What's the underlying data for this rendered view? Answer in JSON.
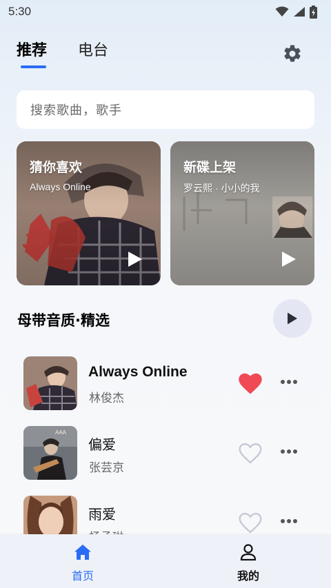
{
  "status_bar": {
    "time": "5:30",
    "icons": [
      "wifi-icon",
      "cellular-signal-icon",
      "battery-icon"
    ]
  },
  "header": {
    "tabs": [
      {
        "label": "推荐",
        "active": true
      },
      {
        "label": "电台",
        "active": false
      }
    ],
    "settings_icon": "gear-icon"
  },
  "search": {
    "placeholder": "搜索歌曲，歌手"
  },
  "cards": [
    {
      "title": "猜你喜欢",
      "subtitle": "Always Online",
      "icon": "play-icon"
    },
    {
      "title": "新碟上架",
      "subtitle": "罗云熙 · 小小的我",
      "icon": "play-icon"
    }
  ],
  "section": {
    "title": "母带音质·精选",
    "play_all_icon": "play-icon"
  },
  "songs": [
    {
      "title": "Always Online",
      "artist": "林俊杰",
      "liked": true
    },
    {
      "title": "偏爱",
      "artist": "张芸京",
      "liked": false
    },
    {
      "title": "雨爱",
      "artist": "杨丞琳",
      "liked": false
    }
  ],
  "bottom_nav": {
    "items": [
      {
        "label": "首页",
        "icon": "home-icon",
        "active": true
      },
      {
        "label": "我的",
        "icon": "user-icon",
        "active": false
      }
    ]
  },
  "colors": {
    "accent": "#2a6cf6",
    "liked_heart": "#f04a55",
    "unliked_heart": "#c4c8d4",
    "play_all_bg": "#e4e6f4"
  }
}
